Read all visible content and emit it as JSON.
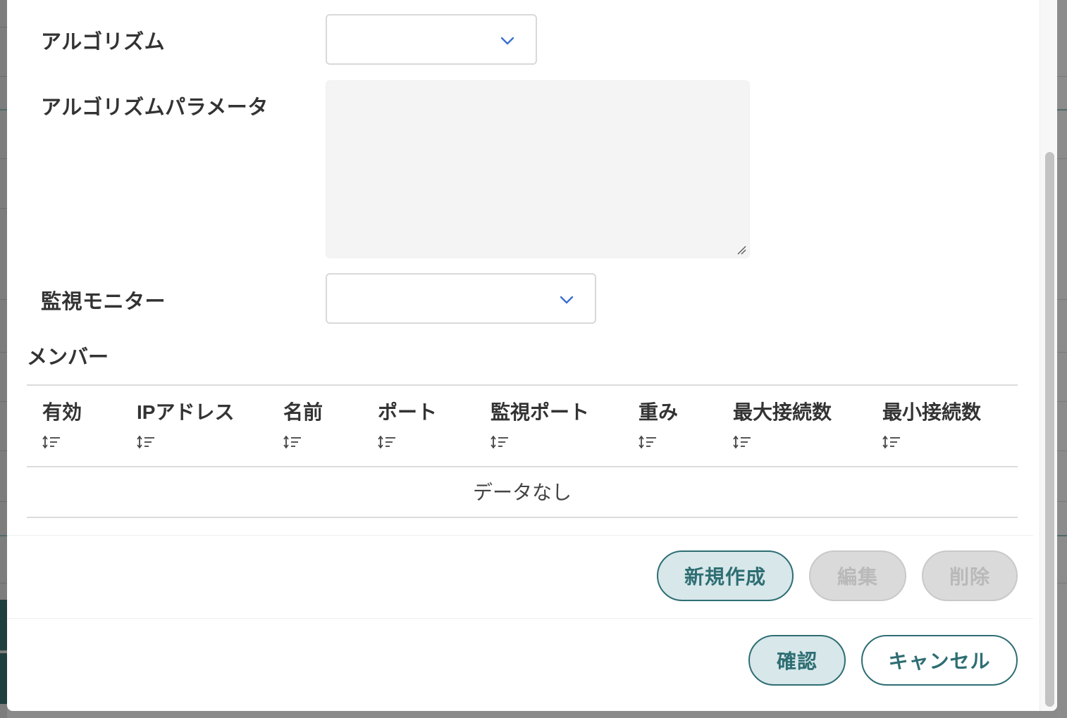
{
  "form": {
    "algorithm_label": "アルゴリズム",
    "algorithm_value": "",
    "algorithm_params_label": "アルゴリズムパラメータ",
    "algorithm_params_value": "",
    "monitor_label": "監視モニター",
    "monitor_value": ""
  },
  "members": {
    "title": "メンバー",
    "columns": [
      {
        "label": "有効",
        "sort_icon": "sort-icon"
      },
      {
        "label": "IPアドレス",
        "sort_icon": "sort-icon"
      },
      {
        "label": "名前",
        "sort_icon": "sort-icon"
      },
      {
        "label": "ポート",
        "sort_icon": "sort-icon"
      },
      {
        "label": "監視ポート",
        "sort_icon": "sort-icon"
      },
      {
        "label": "重み",
        "sort_icon": "sort-icon"
      },
      {
        "label": "最大接続数",
        "sort_icon": "sort-icon"
      },
      {
        "label": "最小接続数",
        "sort_icon": "sort-icon"
      }
    ],
    "empty_text": "データなし",
    "actions": {
      "create_label": "新規作成",
      "edit_label": "編集",
      "delete_label": "削除"
    }
  },
  "footer": {
    "confirm_label": "確認",
    "cancel_label": "キャンセル"
  },
  "colors": {
    "accent": "#2e6e73",
    "accent_bg": "#d7e7ea",
    "chevron": "#3a6fd1",
    "disabled_bg": "#dadada",
    "disabled_text": "#b9b9b9"
  }
}
